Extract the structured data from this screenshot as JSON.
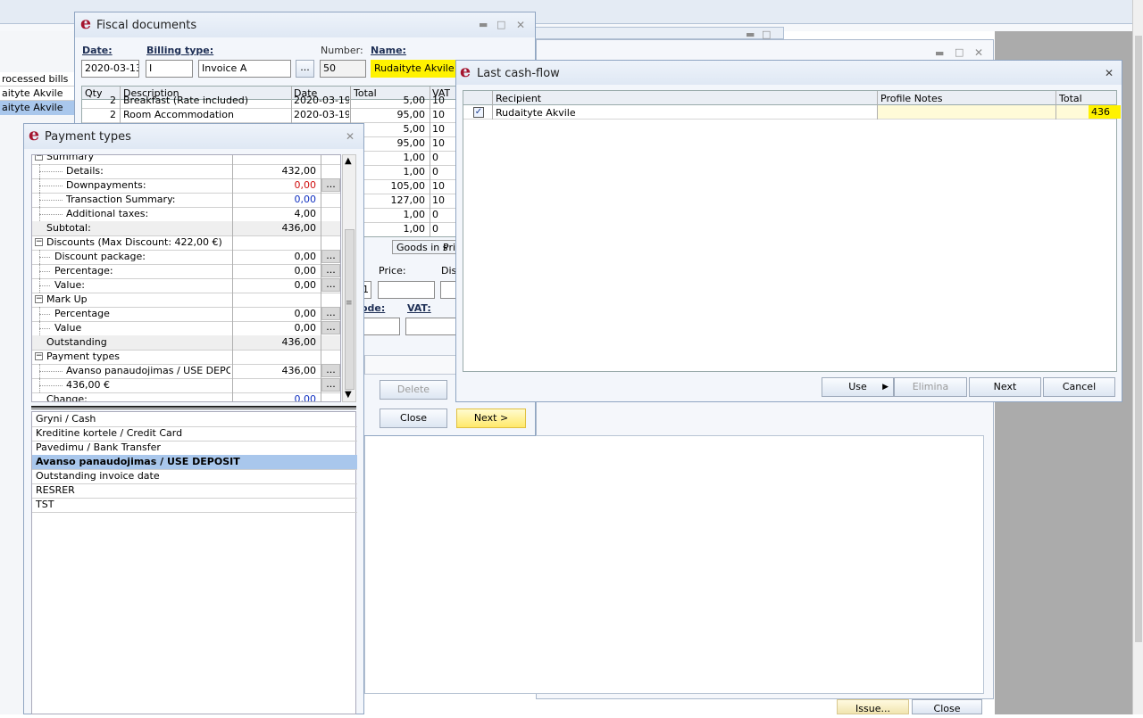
{
  "left_list": {
    "items": [
      "rocessed bills",
      "aityte Akvile",
      "aityte Akvile"
    ]
  },
  "fiscal": {
    "title": "Fiscal documents",
    "date_label": "Date:",
    "date": "2020-03-13",
    "billing_label": "Billing type:",
    "billing_code": "I",
    "billing_name": "Invoice A",
    "number_label": "Number:",
    "number": "50",
    "name_label": "Name:",
    "name": "Rudaityte Akvile",
    "columns": [
      "Qty",
      "Description",
      "Date",
      "Total",
      "VAT"
    ],
    "rows": [
      {
        "qty": "2",
        "desc": "Breakfast (Rate included)",
        "date": "2020-03-19",
        "total": "5,00",
        "vat": "10"
      },
      {
        "qty": "2",
        "desc": "Room Accommodation",
        "date": "2020-03-19",
        "total": "95,00",
        "vat": "10"
      },
      {
        "qty": "",
        "desc": "",
        "date": "",
        "total": "5,00",
        "vat": "10"
      },
      {
        "qty": "",
        "desc": "",
        "date": "",
        "total": "95,00",
        "vat": "10"
      },
      {
        "qty": "",
        "desc": "",
        "date": "",
        "total": "1,00",
        "vat": "0"
      },
      {
        "qty": "",
        "desc": "",
        "date": "",
        "total": "1,00",
        "vat": "0"
      },
      {
        "qty": "",
        "desc": "",
        "date": "",
        "total": "105,00",
        "vat": "10"
      },
      {
        "qty": "",
        "desc": "",
        "date": "",
        "total": "127,00",
        "vat": "10"
      },
      {
        "qty": "",
        "desc": "",
        "date": "",
        "total": "1,00",
        "vat": "0"
      },
      {
        "qty": "",
        "desc": "",
        "date": "",
        "total": "1,00",
        "vat": "0"
      }
    ],
    "tab_goods": "Goods in s",
    "tab_pri": "Pri",
    "price_label": "Price:",
    "dis_label": "Dis",
    "code_label": "ode:",
    "vat_label": "VAT:",
    "qty_value": "1",
    "delete_label": "Delete",
    "close_label": "Close",
    "next_label": "Next >"
  },
  "payment": {
    "title": "Payment types",
    "tree": [
      {
        "label": "Summary",
        "value": "",
        "indent": 1,
        "box": "minus",
        "ell": false
      },
      {
        "label": "Details:",
        "value": "432,00",
        "indent": 3,
        "ell": false
      },
      {
        "label": "Downpayments:",
        "value": "0,00",
        "indent": 3,
        "ell": true,
        "color": "#d01010"
      },
      {
        "label": "Transaction Summary:",
        "value": "0,00",
        "indent": 3,
        "ell": false,
        "color": "#1030c0"
      },
      {
        "label": "Additional taxes:",
        "value": "4,00",
        "indent": 3,
        "ell": false
      },
      {
        "label": "Subtotal:",
        "value": "436,00",
        "indent": 1,
        "ell": false,
        "shade": true
      },
      {
        "label": "Discounts (Max Discount: 422,00 €)",
        "value": "",
        "indent": 1,
        "box": "minus",
        "ell": false
      },
      {
        "label": "Discount package:",
        "value": "0,00",
        "indent": 2,
        "ell": true
      },
      {
        "label": "Percentage:",
        "value": "0,00",
        "indent": 2,
        "ell": true
      },
      {
        "label": "Value:",
        "value": "0,00",
        "indent": 2,
        "ell": true
      },
      {
        "label": "Mark Up",
        "value": "",
        "indent": 1,
        "box": "minus",
        "ell": false
      },
      {
        "label": "Percentage",
        "value": "0,00",
        "indent": 2,
        "ell": true
      },
      {
        "label": "Value",
        "value": "0,00",
        "indent": 2,
        "ell": true
      },
      {
        "label": "Outstanding",
        "value": "436,00",
        "indent": 1,
        "ell": false,
        "shade": true
      },
      {
        "label": "Payment types",
        "value": "",
        "indent": 1,
        "box": "minus",
        "ell": false
      },
      {
        "label": "Avanso panaudojimas / USE DEPOSIT",
        "value": "436,00",
        "indent": 3,
        "ell": true
      },
      {
        "label": "436,00 €",
        "value": "",
        "indent": 3,
        "ell": true
      },
      {
        "label": "Change:",
        "value": "0,00",
        "indent": 1,
        "ell": false,
        "color": "#1030c0"
      }
    ],
    "types": [
      "Gryni / Cash",
      "Kreditine kortele / Credit Card",
      "Pavedimu / Bank Transfer",
      "Avanso panaudojimas / USE DEPOSIT",
      "Outstanding invoice date",
      "RESRER",
      "TST"
    ],
    "selected_index": 3
  },
  "cashflow": {
    "title": "Last cash-flow",
    "columns": [
      "Recipient",
      "Profile Notes",
      "Total"
    ],
    "rows": [
      {
        "checked": true,
        "recipient": "Rudaityte Akvile",
        "notes": "",
        "total": "436"
      }
    ],
    "use_label": "Use",
    "elimina_label": "Elimina",
    "next_label": "Next",
    "cancel_label": "Cancel"
  },
  "bottom": {
    "issue_label": "Issue...",
    "close_label": "Close"
  },
  "colors": {
    "highlight": "#fff200",
    "selected_row": "#a9c7ec",
    "accent_red": "#a5152f"
  }
}
